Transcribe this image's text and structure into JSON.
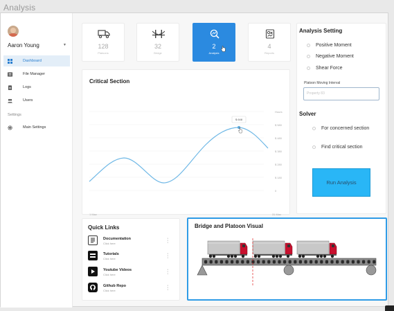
{
  "window": {
    "title": "Analysis"
  },
  "user": {
    "name": "Aaron Young"
  },
  "sidebar": {
    "items": [
      {
        "label": "Dashboard",
        "icon": "dashboard-icon",
        "active": true
      },
      {
        "label": "File Manager",
        "icon": "file-manager-icon",
        "active": false
      },
      {
        "label": "Logs",
        "icon": "logs-icon",
        "active": false
      },
      {
        "label": "Users",
        "icon": "users-icon",
        "active": false
      }
    ],
    "section_label": "Settings",
    "settings_items": [
      {
        "label": "Main Settings",
        "icon": "gear-icon"
      }
    ]
  },
  "stats": [
    {
      "value": "128",
      "label": "Platoons",
      "icon": "truck-icon",
      "active": false
    },
    {
      "value": "32",
      "label": "Bridge",
      "icon": "bridge-icon",
      "active": false
    },
    {
      "value": "2",
      "label": "Analysis",
      "icon": "analysis-icon",
      "active": true
    },
    {
      "value": "4",
      "label": "Reports",
      "icon": "reports-icon",
      "active": false
    }
  ],
  "critical_section": {
    "title": "Critical Section",
    "tooltip": "$ 648",
    "x_labels": [
      "1 May",
      "31 May"
    ],
    "y_labels": [
      "Hours",
      "$ 580",
      "$ 480",
      "$ 380",
      "$ 280",
      "$ 180",
      "0"
    ]
  },
  "analysis_setting": {
    "title": "Analysis Setting",
    "options": [
      "Positive Moment",
      "Negative Moment",
      "Shear Force"
    ],
    "interval_label": "Platoon Moving Interval",
    "interval_placeholder": "Property 83"
  },
  "solver": {
    "title": "Solver",
    "options": [
      "For concerned section",
      "Find critical section"
    ],
    "run_label": "Run Analysis"
  },
  "quick_links": {
    "title": "Quick Links",
    "items": [
      {
        "title": "Documentation",
        "sub": "Click here",
        "icon": "document-icon"
      },
      {
        "title": "Tutorials",
        "sub": "Click here",
        "icon": "tutorials-icon"
      },
      {
        "title": "Youtube Videos",
        "sub": "Click here",
        "icon": "youtube-icon"
      },
      {
        "title": "Github Repo",
        "sub": "Click here",
        "icon": "github-icon"
      }
    ]
  },
  "bridge_visual": {
    "title": "Bridge and Platoon Visual"
  },
  "colors": {
    "accent": "#2b8ae0",
    "run_button": "#29b6f6",
    "curve": "#6fb8e6",
    "truck_cab": "#c8102e",
    "selected_border": "#2e9be6"
  }
}
